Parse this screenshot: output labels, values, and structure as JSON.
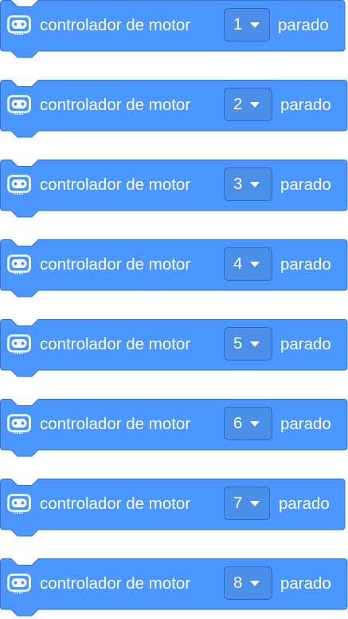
{
  "colors": {
    "block_fill": "#4c97ff",
    "block_stroke": "#3373cc",
    "text": "#ffffff"
  },
  "blocks": [
    {
      "icon": "robot-icon",
      "label": "controlador de motor",
      "motor": "1",
      "state": "parado"
    },
    {
      "icon": "robot-icon",
      "label": "controlador de motor",
      "motor": "2",
      "state": "parado"
    },
    {
      "icon": "robot-icon",
      "label": "controlador de motor",
      "motor": "3",
      "state": "parado"
    },
    {
      "icon": "robot-icon",
      "label": "controlador de motor",
      "motor": "4",
      "state": "parado"
    },
    {
      "icon": "robot-icon",
      "label": "controlador de motor",
      "motor": "5",
      "state": "parado"
    },
    {
      "icon": "robot-icon",
      "label": "controlador de motor",
      "motor": "6",
      "state": "parado"
    },
    {
      "icon": "robot-icon",
      "label": "controlador de motor",
      "motor": "7",
      "state": "parado"
    },
    {
      "icon": "robot-icon",
      "label": "controlador de motor",
      "motor": "8",
      "state": "parado"
    }
  ]
}
